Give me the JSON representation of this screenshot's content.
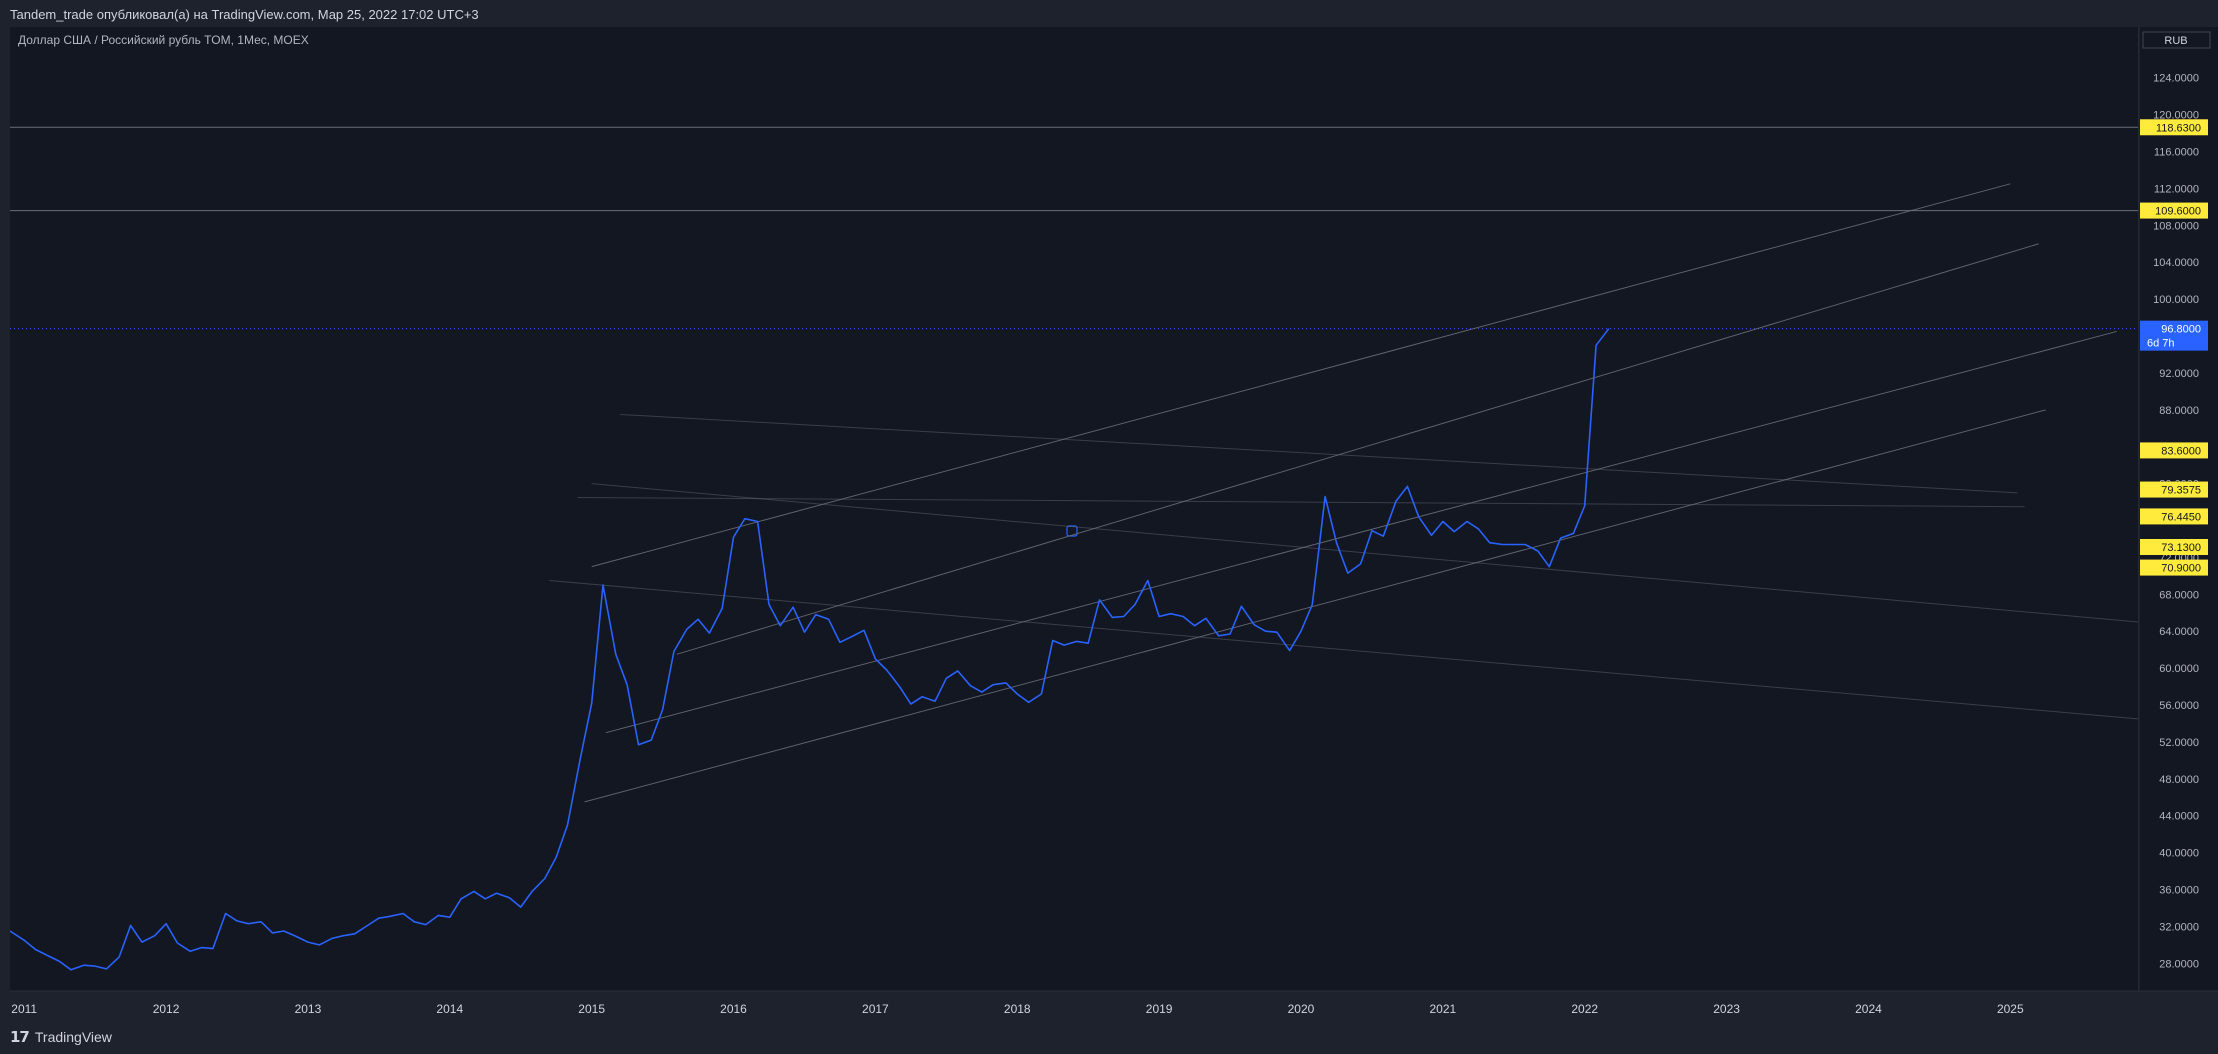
{
  "header": {
    "publisher_line": "Tandem_trade опубликовал(а) на TradingView.com, Мар 25, 2022 17:02 UTC+3"
  },
  "footer": {
    "brand_logo_glyph": "𝟭𝟳",
    "brand_name": "TradingView"
  },
  "colors": {
    "background": "#131722",
    "frame": "#1e222d",
    "series": "#2962ff",
    "price_badge": "#2962ff",
    "level_badge": "#ffeb3b",
    "channel_line": "#6a6f7a",
    "axis_text": "#b2b5be"
  },
  "chart_data": {
    "type": "line",
    "symbol_title": "Доллар США / Российский рубль TOM, 1Мес, MOEX",
    "currency_button": "RUB",
    "y_axis": {
      "range": [
        25,
        129.5
      ],
      "ticks": [
        "28.0000",
        "32.0000",
        "36.0000",
        "40.0000",
        "44.0000",
        "48.0000",
        "52.0000",
        "56.0000",
        "60.0000",
        "64.0000",
        "68.0000",
        "72.0000",
        "80.0000",
        "88.0000",
        "92.0000",
        "100.0000",
        "104.0000",
        "108.0000",
        "112.0000",
        "116.0000",
        "120.0000",
        "124.0000"
      ]
    },
    "x_axis": {
      "range": [
        2010.9,
        2025.9
      ],
      "labels": [
        "2011",
        "2012",
        "2013",
        "2014",
        "2015",
        "2016",
        "2017",
        "2018",
        "2019",
        "2020",
        "2021",
        "2022",
        "2023",
        "2024",
        "2025"
      ]
    },
    "last_price": {
      "value": 96.8,
      "label": "96.8000",
      "countdown": "6d 7h"
    },
    "horizontal_levels": [
      {
        "value": 118.63,
        "label": "118.6300"
      },
      {
        "value": 109.6,
        "label": "109.6000"
      }
    ],
    "level_badges": [
      {
        "value": 83.6,
        "label": "83.6000"
      },
      {
        "value": 79.3575,
        "label": "79.3575"
      },
      {
        "value": 76.445,
        "label": "76.4450"
      },
      {
        "value": 73.13,
        "label": "73.1300"
      },
      {
        "value": 70.9,
        "label": "70.9000"
      }
    ],
    "channel_lines": [
      {
        "x": [
          2015.0,
          2025.0
        ],
        "y": [
          71.0,
          112.5
        ]
      },
      {
        "x": [
          2015.6,
          2025.2
        ],
        "y": [
          61.5,
          106.0
        ]
      },
      {
        "x": [
          2015.1,
          2025.75
        ],
        "y": [
          53.0,
          96.5
        ]
      },
      {
        "x": [
          2014.95,
          2025.25
        ],
        "y": [
          45.5,
          88.0
        ]
      },
      {
        "x": [
          2014.9,
          2025.1
        ],
        "y": [
          78.5,
          77.5
        ]
      },
      {
        "x": [
          2015.2,
          2025.05
        ],
        "y": [
          87.5,
          79.0
        ]
      },
      {
        "x": [
          2015.0,
          2025.9
        ],
        "y": [
          80.0,
          65.0
        ]
      },
      {
        "x": [
          2014.7,
          2025.9
        ],
        "y": [
          69.5,
          54.5
        ]
      }
    ],
    "series": [
      {
        "x": [
          2010.9,
          2011.0,
          2011.08,
          2011.17,
          2011.25,
          2011.33,
          2011.42,
          2011.5,
          2011.58,
          2011.67,
          2011.75,
          2011.83,
          2011.92,
          2012.0,
          2012.08,
          2012.17,
          2012.25,
          2012.33,
          2012.42,
          2012.5,
          2012.58,
          2012.67,
          2012.75,
          2012.83,
          2012.92,
          2013.0,
          2013.08,
          2013.17,
          2013.25,
          2013.33,
          2013.42,
          2013.5,
          2013.58,
          2013.67,
          2013.75,
          2013.83,
          2013.92,
          2014.0,
          2014.08,
          2014.17,
          2014.25,
          2014.33,
          2014.42,
          2014.5,
          2014.58,
          2014.67,
          2014.75,
          2014.83,
          2014.92,
          2015.0,
          2015.08,
          2015.17,
          2015.25,
          2015.33,
          2015.42,
          2015.5,
          2015.58,
          2015.67,
          2015.75,
          2015.83,
          2015.92,
          2016.0,
          2016.08,
          2016.17,
          2016.25,
          2016.33,
          2016.42,
          2016.5,
          2016.58,
          2016.67,
          2016.75,
          2016.83,
          2016.92,
          2017.0,
          2017.08,
          2017.17,
          2017.25,
          2017.33,
          2017.42,
          2017.5,
          2017.58,
          2017.67,
          2017.75,
          2017.83,
          2017.92,
          2018.0,
          2018.08,
          2018.17,
          2018.25,
          2018.33,
          2018.42,
          2018.5,
          2018.58,
          2018.67,
          2018.75,
          2018.83,
          2018.92,
          2019.0,
          2019.08,
          2019.17,
          2019.25,
          2019.33,
          2019.42,
          2019.5,
          2019.58,
          2019.67,
          2019.75,
          2019.83,
          2019.92,
          2020.0,
          2020.08,
          2020.17,
          2020.25,
          2020.33,
          2020.42,
          2020.5,
          2020.58,
          2020.67,
          2020.75,
          2020.83,
          2020.92,
          2021.0,
          2021.08,
          2021.17,
          2021.25,
          2021.33,
          2021.42,
          2021.5,
          2021.58,
          2021.67,
          2021.75,
          2021.83,
          2021.92,
          2022.0,
          2022.08,
          2022.17
        ],
        "y": [
          31.5,
          30.5,
          29.5,
          28.8,
          28.2,
          27.3,
          27.8,
          27.7,
          27.4,
          28.7,
          32.1,
          30.3,
          31.0,
          32.3,
          30.2,
          29.3,
          29.7,
          29.6,
          33.4,
          32.6,
          32.3,
          32.5,
          31.3,
          31.5,
          30.9,
          30.3,
          30.0,
          30.7,
          31.0,
          31.2,
          32.1,
          32.9,
          33.1,
          33.4,
          32.5,
          32.2,
          33.2,
          33.0,
          35.0,
          35.8,
          35.0,
          35.6,
          35.1,
          34.1,
          35.8,
          37.2,
          39.5,
          43.0,
          50.2,
          56.2,
          69.0,
          61.5,
          58.2,
          51.7,
          52.2,
          55.5,
          61.8,
          64.2,
          65.3,
          63.8,
          66.5,
          74.2,
          76.2,
          75.9,
          66.9,
          64.6,
          66.6,
          63.9,
          65.8,
          65.3,
          62.8,
          63.4,
          64.1,
          61.0,
          59.8,
          58.0,
          56.1,
          56.9,
          56.4,
          58.9,
          59.7,
          58.1,
          57.4,
          58.2,
          58.4,
          57.2,
          56.3,
          57.2,
          63.0,
          62.5,
          62.9,
          62.7,
          67.4,
          65.5,
          65.6,
          66.9,
          69.5,
          65.6,
          65.9,
          65.6,
          64.6,
          65.4,
          63.5,
          63.7,
          66.7,
          64.7,
          64.0,
          63.9,
          61.9,
          64.0,
          66.9,
          78.6,
          73.6,
          70.3,
          71.3,
          74.9,
          74.3,
          78.1,
          79.7,
          76.4,
          74.4,
          75.9,
          74.8,
          75.9,
          75.1,
          73.6,
          73.4,
          73.4,
          73.4,
          72.7,
          71.0,
          74.1,
          74.6,
          77.6,
          95.0,
          96.8
        ]
      }
    ]
  }
}
